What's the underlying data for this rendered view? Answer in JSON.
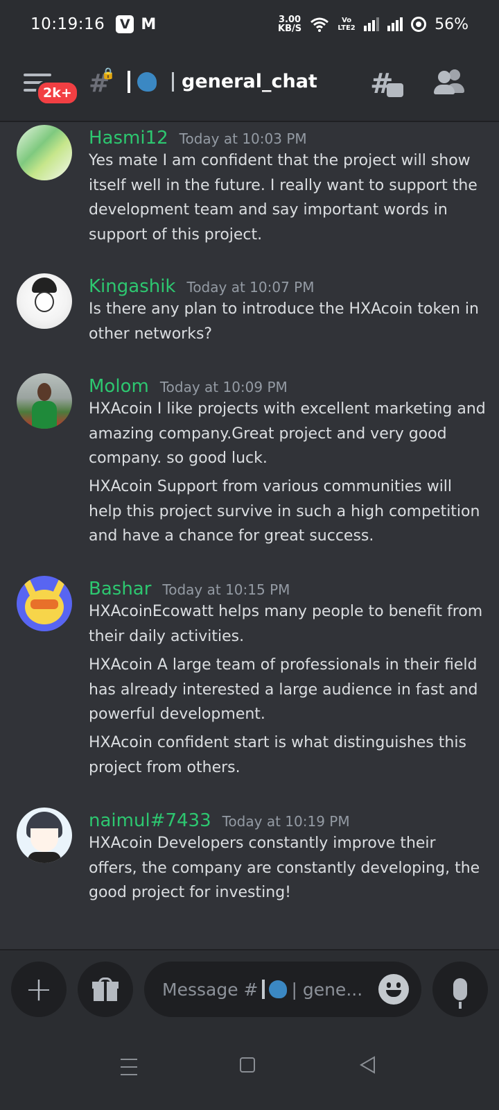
{
  "status_bar": {
    "time": "10:19:16",
    "speed_value": "3.00",
    "speed_unit": "KB/S",
    "volte_label": "Vo LTE2",
    "battery": "56%"
  },
  "header": {
    "notification_badge": "2k+",
    "channel_name": "general_chat"
  },
  "messages": [
    {
      "username": "Hasmi12",
      "timestamp": "Today at 10:03 PM",
      "paragraphs": [
        "Yes mate I am confident that the project will show itself well in the future. I really want to support the development team and say important words in support of this project."
      ]
    },
    {
      "username": "Kingashik",
      "timestamp": "Today at 10:07 PM",
      "paragraphs": [
        "Is there any plan to introduce the HXAcoin token in other networks?"
      ]
    },
    {
      "username": "Molom",
      "timestamp": "Today at 10:09 PM",
      "paragraphs": [
        "HXAcoin I like projects with excellent marketing and amazing company.Great project and very good company. so good luck.",
        "HXAcoin Support from various communities will help this project survive in such a high competition and have a chance for great success."
      ]
    },
    {
      "username": "Bashar",
      "timestamp": "Today at 10:15 PM",
      "paragraphs": [
        "HXAcoinEcowatt helps many people to benefit from their daily activities.",
        "HXAcoin A large team of professionals in their field has already interested a large audience in fast and powerful development.",
        "HXAcoin confident start is what distinguishes this project from others."
      ]
    },
    {
      "username": "naimul#7433",
      "timestamp": "Today at 10:19 PM",
      "paragraphs": [
        "HXAcoin Developers constantly improve their offers, the company are constantly developing, the good project for investing!"
      ]
    }
  ],
  "composer": {
    "placeholder_prefix": "Message #",
    "placeholder_suffix": "| gene..."
  },
  "colors": {
    "background": "#313338",
    "username": "#2dc770",
    "timestamp": "#949ba4",
    "badge": "#f23f43"
  }
}
